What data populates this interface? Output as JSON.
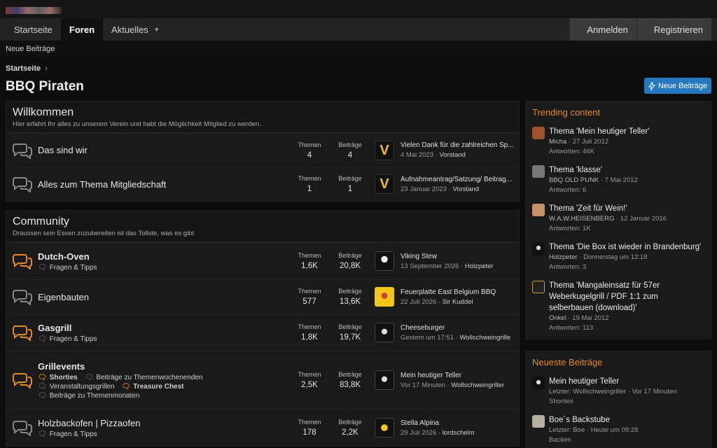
{
  "nav": {
    "tabs": [
      {
        "label": "Startseite"
      },
      {
        "label": "Foren"
      },
      {
        "label": "Aktuelles"
      }
    ],
    "login": "Anmelden",
    "register": "Registrieren",
    "subnav": "Neue Beiträge"
  },
  "breadcrumb": "Startseite",
  "page_title": "BBQ Piraten",
  "new_posts_button": "Neue Beiträge",
  "labels": {
    "threads": "Themen",
    "posts": "Beiträge"
  },
  "categories": [
    {
      "title": "Willkommen",
      "desc": "Hier erfahrt Ihr alles zu unserem Verein und habt die Möglichkeit Mitglied zu werden.",
      "nodes": [
        {
          "title": "Das sind wir",
          "threads": "4",
          "posts": "4",
          "last_title": "Vielen Dank für die zahlreichen Sp...",
          "last_date": "4 Mai 2023",
          "last_user": "Vorstand"
        },
        {
          "title": "Alles zum Thema Mitgliedschaft",
          "threads": "1",
          "posts": "1",
          "last_title": "Aufnahmeantrag/Satzung/ Beitrag...",
          "last_date": "23 Januar 2023",
          "last_user": "Vorstand"
        }
      ]
    },
    {
      "title": "Community",
      "desc": "Draussen sein Essen zuzubereiten ist das Tollste, was es gibt",
      "nodes": [
        {
          "title": "Dutch-Oven",
          "sub": [
            "Fragen & Tipps"
          ],
          "threads": "1,6K",
          "posts": "20,8K",
          "last_title": "Viking Stew",
          "last_date": "13 September 2026",
          "last_user": "Holzpeter"
        },
        {
          "title": "Eigenbauten",
          "threads": "577",
          "posts": "13,6K",
          "last_title": "Feuerplatte East Belgium BBQ",
          "last_date": "22 Juli 2026",
          "last_user": "Sir Kuddel"
        },
        {
          "title": "Gasgrill",
          "sub": [
            "Fragen & Tipps"
          ],
          "threads": "1,8K",
          "posts": "19,7K",
          "last_title": "Cheeseburger",
          "last_date": "Gestern um 17:51",
          "last_user": "Wollschweingrille"
        },
        {
          "title": "Grillevents",
          "sub": [
            "Shorties",
            "Beiträge zu Themenwochenenden",
            "Veranstaltungsgrillen",
            "Treasure Chest",
            "Beiträge zu Themenmonaten"
          ],
          "threads": "2,5K",
          "posts": "83,8K",
          "last_title": "Mein heutiger Teller",
          "last_date": "Vor 17 Minuten",
          "last_user": "Wollschweingriller"
        },
        {
          "title": "Holzbackofen | Pizzaofen",
          "sub": [
            "Fragen & Tipps"
          ],
          "threads": "178",
          "posts": "2,2K",
          "last_title": "Stella Alpina",
          "last_date": "29 Juli 2026",
          "last_user": "lordschelm"
        }
      ]
    }
  ],
  "trending": {
    "title": "Trending content",
    "items": [
      {
        "title": "Thema 'Mein heutiger Teller'",
        "user": "Micha",
        "date": "27 Juli 2012",
        "replies": "Antworten: 46K"
      },
      {
        "title": "Thema 'klasse'",
        "user": "BBQ OLD PUNK",
        "date": "7 Mai 2012",
        "replies": "Antworten: 6"
      },
      {
        "title": "Thema 'Zeit für Wein!'",
        "user": "W.A.W.HEISENBERG",
        "date": "12 Januar 2016",
        "replies": "Antworten: 1K"
      },
      {
        "title": "Thema 'Die Box ist wieder in Brandenburg'",
        "user": "Holzpeter",
        "date": "Donnerstag um 12:18",
        "replies": "Antworten: 3"
      },
      {
        "title": "Thema 'Mangaleinsatz für 57er Weberkugelgrill / PDF 1:1 zum selberbauen (download)'",
        "user": "Onkel",
        "date": "19 Mai 2012",
        "replies": "Antworten: 113"
      }
    ]
  },
  "newest": {
    "title": "Neueste Beiträge",
    "items": [
      {
        "title": "Mein heutiger Teller",
        "meta": "Letzter: Wollschweingriller",
        "date": "Vor 17 Minuten",
        "forum": "Shorties"
      },
      {
        "title": "Boe´s Backstube",
        "meta": "Letzter: Boe",
        "date": "Heute um 09:28",
        "forum": "Backen"
      }
    ]
  },
  "colors": {
    "accent": "#e58a1f",
    "button": "#2577c0",
    "bg": "#101010"
  }
}
